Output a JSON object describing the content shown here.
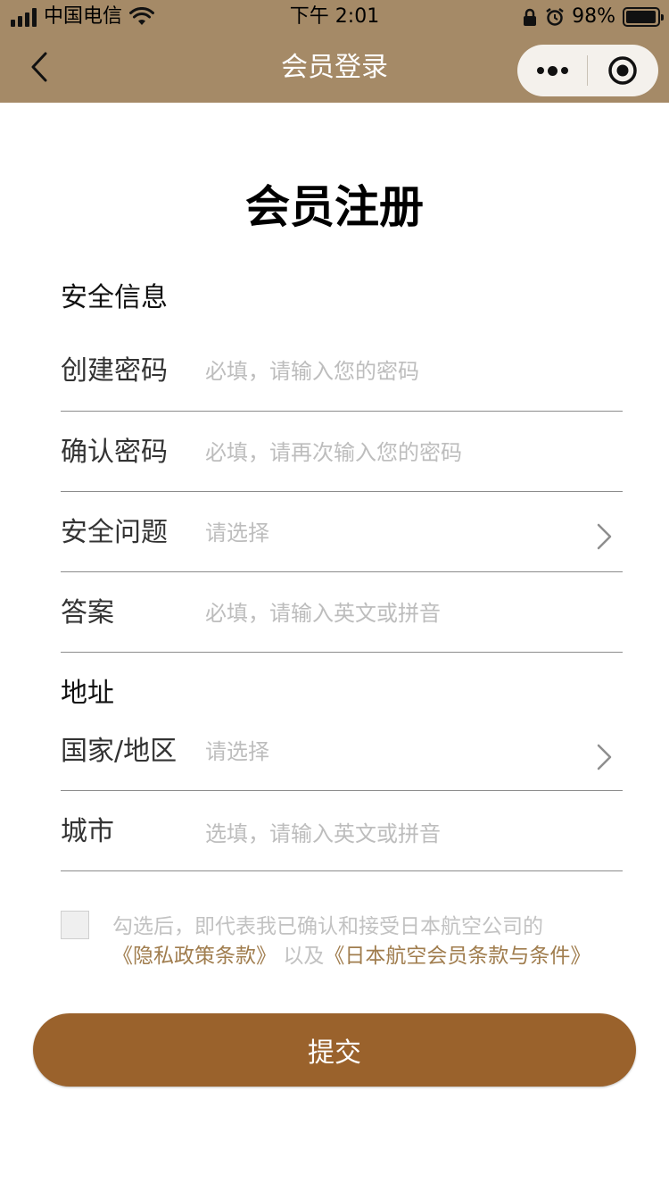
{
  "status_bar": {
    "carrier": "中国电信",
    "time": "下午 2:01",
    "battery": "98%",
    "battery_level": 0.98
  },
  "nav": {
    "title": "会员登录",
    "back_icon": "chevron-left-icon",
    "more_icon": "more-dots-icon",
    "close_icon": "target-circle-icon",
    "bg_color": "#a58a67"
  },
  "page": {
    "title": "会员注册"
  },
  "security": {
    "section_title": "安全信息",
    "create_password": {
      "label": "创建密码",
      "placeholder": "必填，请输入您的密码",
      "value": ""
    },
    "confirm_password": {
      "label": "确认密码",
      "placeholder": "必填，请再次输入您的密码",
      "value": ""
    },
    "question": {
      "label": "安全问题",
      "placeholder": "请选择"
    },
    "answer": {
      "label": "答案",
      "placeholder": "必填，请输入英文或拼音",
      "value": ""
    }
  },
  "address": {
    "section_title": "地址",
    "country": {
      "label": "国家/地区",
      "placeholder": "请选择"
    },
    "city": {
      "label": "城市",
      "placeholder": "选填，请输入英文或拼音",
      "value": ""
    }
  },
  "agreement": {
    "checked": false,
    "text_prefix": "勾选后，即代表我已确认和接受日本航空公司的",
    "privacy_link": "《隐私政策条款》",
    "connector": "以及",
    "terms_link": "《日本航空会员条款与条件》",
    "link_color": "#a07d4e"
  },
  "submit": {
    "label": "提交",
    "color": "#9a622c"
  }
}
